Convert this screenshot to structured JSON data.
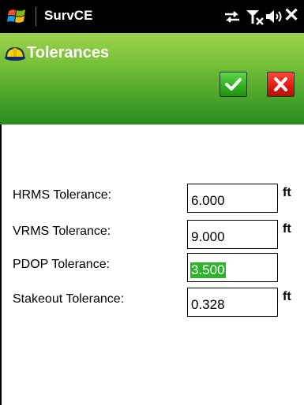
{
  "title_bar": {
    "app_name": "SurvCE",
    "close_glyph": "✕",
    "icons": [
      "windows-start-icon",
      "connection-icon",
      "signal-off-icon",
      "volume-icon",
      "close-icon"
    ]
  },
  "header": {
    "title": "Tolerances",
    "icon": "hardhat-icon",
    "ok_icon": "checkmark-icon",
    "cancel_icon": "x-icon",
    "accent_color": "#4fa82c",
    "ok_color": "#32b31f",
    "cancel_color": "#e21c12"
  },
  "form": {
    "fields": [
      {
        "label": "HRMS Tolerance:",
        "value": "6.000",
        "unit": "ft"
      },
      {
        "label": "VRMS Tolerance:",
        "value": "9.000",
        "unit": "ft"
      },
      {
        "label": "PDOP Tolerance:",
        "value": "3.500",
        "unit": ""
      },
      {
        "label": "Stakeout Tolerance:",
        "value": "0.328",
        "unit": "ft"
      }
    ]
  }
}
